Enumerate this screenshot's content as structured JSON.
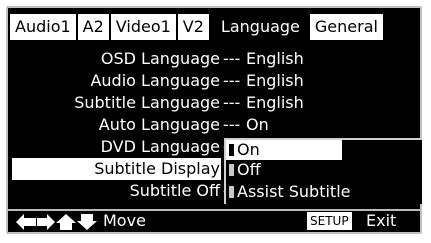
{
  "tabs": [
    {
      "label": "Audio1"
    },
    {
      "label": "A2"
    },
    {
      "label": "Video1"
    },
    {
      "label": "V2"
    },
    {
      "label": "Language"
    },
    {
      "label": "General"
    }
  ],
  "rows": [
    {
      "label": "OSD Language",
      "sep": "---",
      "value": "English"
    },
    {
      "label": "Audio Language",
      "sep": "---",
      "value": "English"
    },
    {
      "label": "Subtitle Language",
      "sep": "---",
      "value": "English"
    },
    {
      "label": "Auto Language",
      "sep": "---",
      "value": "On"
    },
    {
      "label": "DVD Language",
      "sep": "-",
      "value": ""
    },
    {
      "label": "Subtitle Display",
      "sep": "",
      "value": ""
    },
    {
      "label": "Subtitle Off",
      "sep": "-",
      "value": ""
    }
  ],
  "popup": {
    "options": [
      {
        "label": "On"
      },
      {
        "label": "Off"
      },
      {
        "label": "Assist Subtitle"
      }
    ]
  },
  "footer": {
    "move_label": "Move",
    "setup_label": "SETUP",
    "exit_label": "Exit"
  }
}
